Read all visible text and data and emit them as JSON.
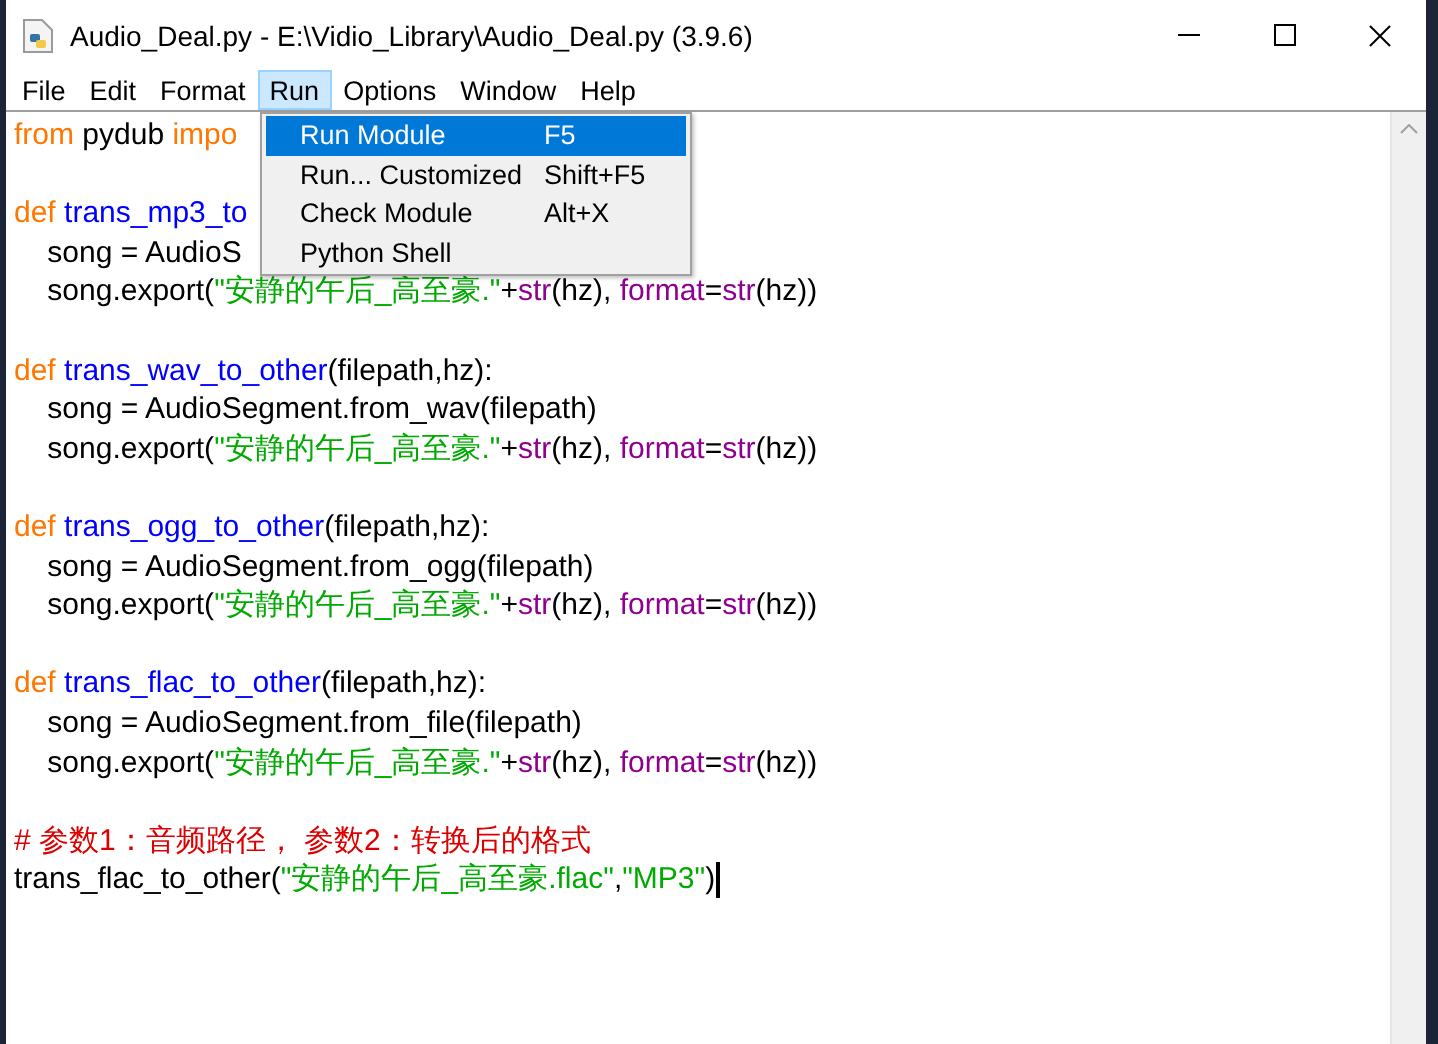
{
  "window": {
    "title": "Audio_Deal.py - E:\\Vidio_Library\\Audio_Deal.py (3.9.6)"
  },
  "menu_bar": [
    {
      "label": "File",
      "selected": false
    },
    {
      "label": "Edit",
      "selected": false
    },
    {
      "label": "Format",
      "selected": false
    },
    {
      "label": "Run",
      "selected": true
    },
    {
      "label": "Options",
      "selected": false
    },
    {
      "label": "Window",
      "selected": false
    },
    {
      "label": "Help",
      "selected": false
    }
  ],
  "run_menu": [
    {
      "label": "Run Module",
      "shortcut": "F5",
      "selected": true
    },
    {
      "label": "Run... Customized",
      "shortcut": "Shift+F5",
      "selected": false
    },
    {
      "label": "Check Module",
      "shortcut": "Alt+X",
      "selected": false
    },
    {
      "label": "Python Shell",
      "selected": false
    }
  ],
  "code_lines": [
    {
      "tokens": [
        {
          "kind": "keyword",
          "text": "from"
        },
        {
          "kind": "plain",
          "text": " pydub "
        },
        {
          "kind": "keyword",
          "text": "impo"
        }
      ]
    },
    {
      "blank_before": true,
      "tokens": [
        {
          "kind": "keyword",
          "text": "def"
        },
        {
          "kind": "defname",
          "text": " trans_mp3_to"
        }
      ]
    },
    {
      "tokens": [
        {
          "kind": "plain",
          "text": "    song = AudioS"
        }
      ]
    },
    {
      "tokens": [
        {
          "kind": "plain",
          "text": "    song.export("
        },
        {
          "kind": "string",
          "text": "\"安静的午后_高至豪.\""
        },
        {
          "kind": "plain",
          "text": "+"
        },
        {
          "kind": "builtin",
          "text": "str"
        },
        {
          "kind": "plain",
          "text": "(hz), "
        },
        {
          "kind": "builtin",
          "text": "format"
        },
        {
          "kind": "plain",
          "text": "="
        },
        {
          "kind": "builtin",
          "text": "str"
        },
        {
          "kind": "plain",
          "text": "(hz))"
        }
      ]
    },
    {
      "blank_before": true,
      "tokens": [
        {
          "kind": "keyword",
          "text": "def"
        },
        {
          "kind": "defname",
          "text": " trans_wav_to_other"
        },
        {
          "kind": "plain",
          "text": "(filepath,hz):"
        }
      ]
    },
    {
      "tokens": [
        {
          "kind": "plain",
          "text": "    song = AudioSegment.from_wav(filepath)"
        }
      ]
    },
    {
      "tokens": [
        {
          "kind": "plain",
          "text": "    song.export("
        },
        {
          "kind": "string",
          "text": "\"安静的午后_高至豪.\""
        },
        {
          "kind": "plain",
          "text": "+"
        },
        {
          "kind": "builtin",
          "text": "str"
        },
        {
          "kind": "plain",
          "text": "(hz), "
        },
        {
          "kind": "builtin",
          "text": "format"
        },
        {
          "kind": "plain",
          "text": "="
        },
        {
          "kind": "builtin",
          "text": "str"
        },
        {
          "kind": "plain",
          "text": "(hz))"
        }
      ]
    },
    {
      "blank_before": true,
      "tokens": [
        {
          "kind": "keyword",
          "text": "def"
        },
        {
          "kind": "defname",
          "text": " trans_ogg_to_other"
        },
        {
          "kind": "plain",
          "text": "(filepath,hz):"
        }
      ]
    },
    {
      "tokens": [
        {
          "kind": "plain",
          "text": "    song = AudioSegment.from_ogg(filepath)"
        }
      ]
    },
    {
      "tokens": [
        {
          "kind": "plain",
          "text": "    song.export("
        },
        {
          "kind": "string",
          "text": "\"安静的午后_高至豪.\""
        },
        {
          "kind": "plain",
          "text": "+"
        },
        {
          "kind": "builtin",
          "text": "str"
        },
        {
          "kind": "plain",
          "text": "(hz), "
        },
        {
          "kind": "builtin",
          "text": "format"
        },
        {
          "kind": "plain",
          "text": "="
        },
        {
          "kind": "builtin",
          "text": "str"
        },
        {
          "kind": "plain",
          "text": "(hz))"
        }
      ]
    },
    {
      "blank_before": true,
      "tokens": [
        {
          "kind": "keyword",
          "text": "def"
        },
        {
          "kind": "defname",
          "text": " trans_flac_to_other"
        },
        {
          "kind": "plain",
          "text": "(filepath,hz):"
        }
      ]
    },
    {
      "tokens": [
        {
          "kind": "plain",
          "text": "    song = AudioSegment.from_file(filepath)"
        }
      ]
    },
    {
      "tokens": [
        {
          "kind": "plain",
          "text": "    song.export("
        },
        {
          "kind": "string",
          "text": "\"安静的午后_高至豪.\""
        },
        {
          "kind": "plain",
          "text": "+"
        },
        {
          "kind": "builtin",
          "text": "str"
        },
        {
          "kind": "plain",
          "text": "(hz), "
        },
        {
          "kind": "builtin",
          "text": "format"
        },
        {
          "kind": "plain",
          "text": "="
        },
        {
          "kind": "builtin",
          "text": "str"
        },
        {
          "kind": "plain",
          "text": "(hz))"
        }
      ]
    },
    {
      "blank_before": true,
      "tokens": [
        {
          "kind": "comment",
          "text": "# 参数1：音频路径， 参数2：转换后的格式"
        }
      ]
    },
    {
      "tokens": [
        {
          "kind": "plain",
          "text": "trans_flac_to_other("
        },
        {
          "kind": "string",
          "text": "\"安静的午后_高至豪.flac\""
        },
        {
          "kind": "plain",
          "text": ","
        },
        {
          "kind": "string",
          "text": "\"MP3\""
        },
        {
          "kind": "plain",
          "text": ")"
        }
      ]
    }
  ]
}
